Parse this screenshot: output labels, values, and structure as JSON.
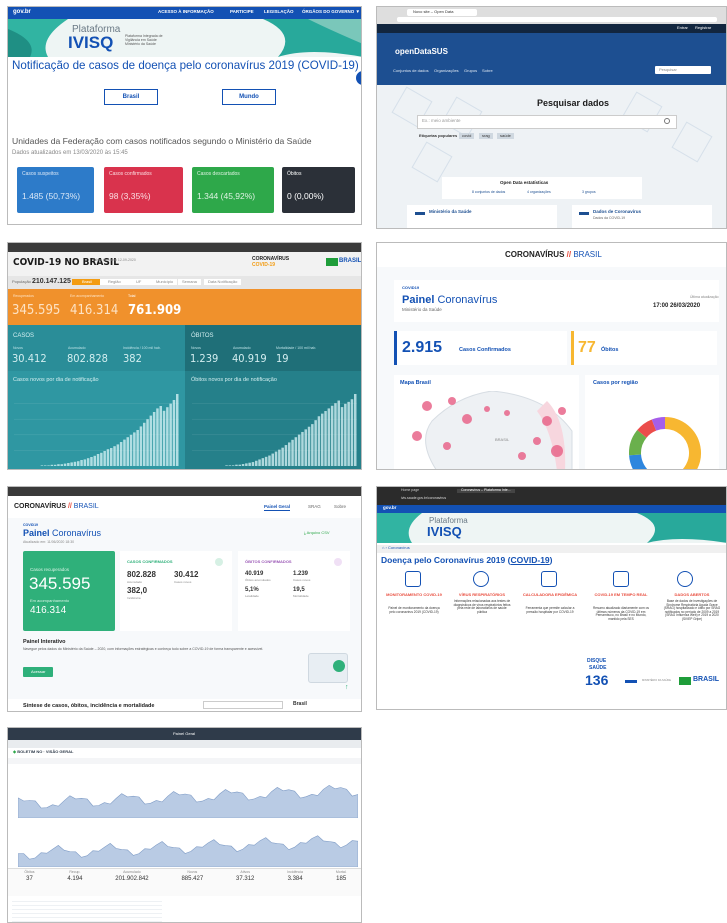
{
  "s1": {
    "gov": "gov.br",
    "nav": [
      "ACESSO À INFORMAÇÃO",
      "PARTICIPE",
      "LEGISLAÇÃO",
      "ÓRGÃOS DO GOVERNO ▼"
    ],
    "brand_top": "Plataforma",
    "brand_main": "IVISQ",
    "brand_sub": "Plataforma Integrada de Vigilância em Saúde Ministério da Saúde",
    "title": "Notificação de casos de doença pelo coronavírus 2019 (COVID-19)",
    "btn_brasil": "Brasil",
    "btn_mundo": "Mundo",
    "sub_title": "Unidades da Federação com casos notificados segundo o Ministério da Saúde",
    "updated": "Dados atualizados em 13/03/2020 às 15:45",
    "cards": [
      {
        "label": "Casos suspeitos",
        "value": "1.485 (50,73%)",
        "color": "#2d7bc9"
      },
      {
        "label": "Casos confirmados",
        "value": "98 (3,35%)",
        "color": "#d9334d"
      },
      {
        "label": "Casos descartados",
        "value": "1.344 (45,92%)",
        "color": "#2ea84a"
      },
      {
        "label": "Óbitos",
        "value": "0 (0,00%)",
        "color": "#2b3038"
      }
    ]
  },
  "s2": {
    "tab": "Novo site – Open Data",
    "top_links": [
      "Entrar",
      "Registrar"
    ],
    "logo": "openDataSUS",
    "menu": [
      "Conjuntos de dados",
      "Organizações",
      "Grupos",
      "Sobre"
    ],
    "search_small": "Pesquisar",
    "hero": "Pesquisar dados",
    "search_ph": "Ex.: meio ambiente",
    "popular": "Etiquetas populares",
    "tags": [
      "covid",
      "srag",
      "saúde"
    ],
    "stats_title": "Open Data estatísticas",
    "stats": [
      "8 conjuntos de dados",
      "4 organizações",
      "3 grupos"
    ],
    "links": [
      "Ministério da Saúde",
      "Dados de Coronavírus"
    ],
    "links_sub": [
      "",
      "Dados da COVID-19"
    ]
  },
  "s3": {
    "title": "COVID-19 NO BRASIL",
    "title_sub": "Painel interativo 12-09-2020",
    "brand1": "CORONAVÍRUS",
    "brand2": "COVID-19",
    "brasil": "BRASIL",
    "gov": "PÁTRIA AMADA",
    "pop_label": "População",
    "pop": "210.147.125",
    "filters": [
      "Brasil",
      "Região",
      "UF",
      "Município",
      "Semana",
      "Data Notificação"
    ],
    "orange": [
      {
        "label": "Recuperados",
        "value": "345.595"
      },
      {
        "label": "Em acompanhamento",
        "value": "416.314"
      },
      {
        "label": "Total",
        "value": "761.909"
      }
    ],
    "casos_h": "CASOS",
    "casos": [
      {
        "label": "Novos",
        "value": "30.412"
      },
      {
        "label": "Acumulado",
        "value": "802.828"
      },
      {
        "label": "Incidência / 100 mil hab.",
        "value": "382"
      }
    ],
    "obitos_h": "ÓBITOS",
    "obitos": [
      {
        "label": "Novos",
        "value": "1.239"
      },
      {
        "label": "Acumulado",
        "value": "40.919"
      },
      {
        "label": "Mortalidade / 100 mil hab.",
        "value": "19"
      }
    ],
    "chart1": "Casos novos por dia de notificação",
    "chart2": "Óbitos novos por dia de notificação",
    "bars1": [
      0,
      0,
      0,
      0,
      0,
      0,
      0,
      0,
      1,
      1,
      1,
      2,
      2,
      3,
      3,
      4,
      5,
      6,
      7,
      8,
      10,
      11,
      13,
      15,
      17,
      20,
      22,
      25,
      28,
      30,
      33,
      36,
      40,
      44,
      48,
      52,
      56,
      60,
      66,
      72,
      78,
      84,
      90,
      96,
      100,
      92,
      98,
      104,
      110,
      120
    ],
    "bars2": [
      0,
      0,
      0,
      0,
      0,
      0,
      0,
      0,
      0,
      0,
      1,
      1,
      1,
      2,
      2,
      3,
      4,
      5,
      6,
      8,
      10,
      12,
      14,
      16,
      19,
      22,
      25,
      28,
      32,
      36,
      40,
      44,
      48,
      52,
      56,
      60,
      64,
      70,
      76,
      80,
      84,
      88,
      92,
      96,
      100,
      90,
      95,
      98,
      102,
      110
    ]
  },
  "s4": {
    "brand": "CORONAVÍRUS",
    "brand2": "BRASIL",
    "tag": "COVID19",
    "title_bold": "Painel",
    "title_rest": "Coronavírus",
    "ministry": "Ministério da Saúde",
    "upd_label": "Última atualização",
    "upd": "17:00 26/03/2020",
    "confirmed_num": "2.915",
    "confirmed_label": "Casos Confirmados",
    "deaths_num": "77",
    "deaths_label": "Óbitos",
    "map_title": "Mapa Brasil",
    "map_label": "BRASIL",
    "region_title": "Casos por região",
    "region_share": [
      44,
      30,
      12,
      8,
      6
    ],
    "region_colors": [
      "#f7b731",
      "#2e86de",
      "#6ab04c",
      "#eb4d4b",
      "#a55eea"
    ]
  },
  "s5": {
    "brand": "CORONAVÍRUS",
    "brand2": "BRASIL",
    "nav": [
      "Painel Geral",
      "SRAG",
      "Sobre"
    ],
    "tag": "COVID19",
    "title_bold": "Painel",
    "title_rest": "Coronavírus",
    "updated": "Atualizado em: 11/06/2020 18:30",
    "csv": "Arquivo CSV",
    "rec_label": "Casos recuperados",
    "rec": "345.595",
    "acomp_label": "Em acompanhamento",
    "acomp": "416.314",
    "casos_h": "CASOS CONFIRMADOS",
    "casos_acum": "802.828",
    "casos_acum_l": "Acumulado",
    "casos_novos": "30.412",
    "casos_novos_l": "Casos novos",
    "incid": "382,0",
    "incid_l": "Incidência",
    "obitos_h": "ÓBITOS CONFIRMADOS",
    "ob_acum": "40.919",
    "ob_acum_l": "Óbitos acumulados",
    "ob_novos": "1.239",
    "ob_novos_l": "Casos novos",
    "let": "5,1%",
    "let_l": "Letalidade",
    "mort": "19,5",
    "mort_l": "Mortalidade",
    "pi_title": "Painel Interativo",
    "pi_text": "Navegue pelos dados do Ministério da Saúde – 2020, com informações estratégicas e conheça todo sobre a COVID-19 de forma transparente e acessível.",
    "pi_btn": "Acessar",
    "footer_title": "Síntese de casos, óbitos, incidência e mortalidade",
    "footer_sel": "Brasil"
  },
  "s6": {
    "tabs": [
      "Home page",
      "Coronavírus – Plataforma Inte..."
    ],
    "url": "ivis.saude.gov.br/coronavirus",
    "gov": "gov.br",
    "brand_top": "Plataforma",
    "brand_main": "IVISQ",
    "crumb": "Coronavírus",
    "title_pre": "Doença pelo Coronavírus 2019 (",
    "title_link": "COVID-19",
    "title_post": ")",
    "cols": [
      {
        "h": "MONITORAMENTO COVID-19",
        "t": "Painel de monitoramento da doença pelo coronavírus 2019 (COVID-19)"
      },
      {
        "h": "VÍRUS RESPIRATÓRIOS",
        "t": "Informações relacionadas aos testes de diagnósticos de vírus respiratórios feitos pela rede de laboratórios de saúde pública"
      },
      {
        "h": "CALCULADORA EPIDÊMICA",
        "t": "Ferramenta que permite calcular a pressão hospitalar por COVID-19"
      },
      {
        "h": "COVID-19 EM TEMPO REAL",
        "t": "Resumo atualizado diariamente com os últimos números da COVID-19 em Pernambuco, no Brasil e no Mundo, mantido pela SES"
      },
      {
        "h": "DADOS ABERTOS",
        "t": "Base de dados de investigações de Síndrome Respiratória Aguda Grave (SRAG) hospitalizado e óbito por SRAG notificados no período de 2009 a 2019 (SRAG Influenza Web) e 2019 a 2020 (SIVEP Gripe)"
      }
    ],
    "disque1": "DISQUE",
    "disque2": "SAÚDE",
    "disque3": "136",
    "brasil": "BRASIL",
    "gov_label": "MINISTÉRIO DA SAÚDE"
  },
  "s7": {
    "title": "Painel Geral",
    "cmd": "BOLETIM NO",
    "cmd2": "VISÃO GERAL",
    "stats": [
      {
        "l": "Óbitos",
        "v": "37"
      },
      {
        "l": "Recup.",
        "v": "4.194"
      },
      {
        "l": "Acumulado",
        "v": "201.902.842"
      },
      {
        "l": "Novos",
        "v": "885.427"
      },
      {
        "l": "Ativos",
        "v": "37.312"
      },
      {
        "l": "Incidência",
        "v": "3.384"
      },
      {
        "l": "Mortal.",
        "v": "185"
      }
    ]
  }
}
